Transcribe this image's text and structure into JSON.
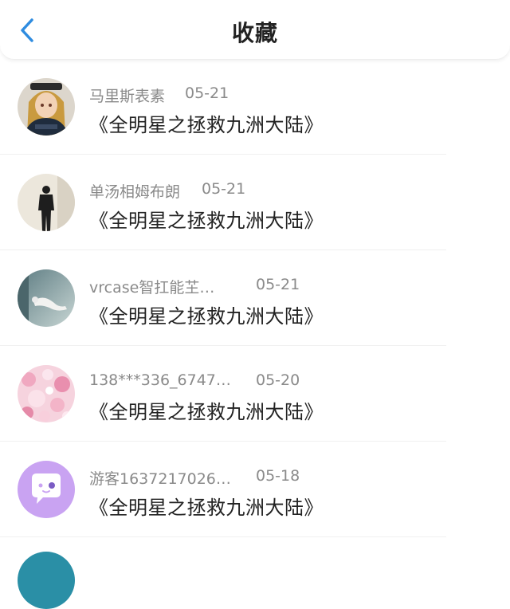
{
  "header": {
    "title": "收藏",
    "back_icon": "chevron-left-icon",
    "accent_color": "#2f8ce0"
  },
  "items": [
    {
      "name": "马里斯表素",
      "date": "05-21",
      "text": "《全明星之拯救九洲大陆》",
      "avatar": "girl-portrait"
    },
    {
      "name": "单汤相姆布朗",
      "date": "05-21",
      "text": "《全明星之拯救九洲大陆》",
      "avatar": "silhouette-man"
    },
    {
      "name": "vrcase智扛能芏…",
      "date": "05-21",
      "text": "《全明星之拯救九洲大陆》",
      "avatar": "floating-figure"
    },
    {
      "name": "138***336_6747…",
      "date": "05-20",
      "text": "《全明星之拯救九洲大陆》",
      "avatar": "pink-flowers"
    },
    {
      "name": "游客1637217026…",
      "date": "05-18",
      "text": "《全明星之拯救九洲大陆》",
      "avatar": "purple-chat-bubble"
    }
  ]
}
